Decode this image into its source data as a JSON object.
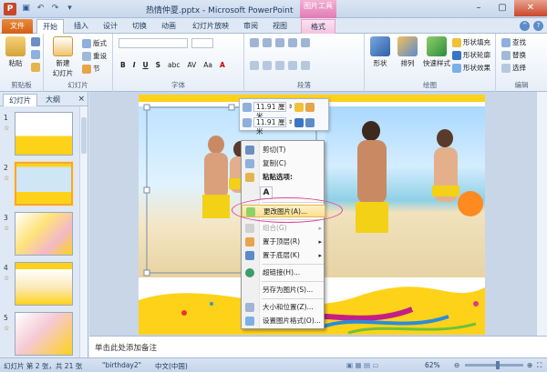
{
  "titlebar": {
    "filename": "热情仲夏.pptx",
    "app": "Microsoft PowerPoint",
    "separator": " - ",
    "context_tab_group": "图片工具"
  },
  "tabs": [
    "文件",
    "开始",
    "插入",
    "设计",
    "切换",
    "动画",
    "幻灯片放映",
    "审阅",
    "视图",
    "格式"
  ],
  "ribbon": {
    "clipboard": {
      "label": "剪贴板",
      "paste": "粘贴"
    },
    "slides": {
      "label": "幻灯片",
      "new_slide": "新建",
      "new_slide2": "幻灯片",
      "layout": "版式",
      "reset": "重设",
      "section": "节"
    },
    "font": {
      "label": "字体",
      "buttons": [
        "B",
        "I",
        "U",
        "S",
        "abc",
        "AV",
        "Aa",
        "A"
      ]
    },
    "paragraph": {
      "label": "段落"
    },
    "drawing": {
      "label": "绘图",
      "shapes": "形状",
      "arrange": "排列",
      "quick_styles": "快速样式",
      "fill": "形状填充",
      "outline": "形状轮廓",
      "effects": "形状效果"
    },
    "editing": {
      "label": "编辑",
      "find": "查找",
      "replace": "替换",
      "select": "选择"
    }
  },
  "leftpane": {
    "tab_slides": "幻灯片",
    "tab_outline": "大纲",
    "close": "×",
    "thumbnails": [
      {
        "num": "1",
        "selected": false
      },
      {
        "num": "2",
        "selected": true
      },
      {
        "num": "3",
        "selected": false
      },
      {
        "num": "4",
        "selected": false
      },
      {
        "num": "5",
        "selected": false
      }
    ]
  },
  "minibar": {
    "height_value": "11.91 厘米",
    "width_value": "11.91 厘米"
  },
  "context_menu": {
    "items": [
      {
        "label": "剪切(T)",
        "disabled": false,
        "highlight": false,
        "submenu": false
      },
      {
        "label": "复制(C)",
        "disabled": false,
        "highlight": false,
        "submenu": false
      },
      {
        "label": "粘贴选项:",
        "disabled": false,
        "highlight": false,
        "submenu": false,
        "bold": true
      },
      {
        "label": "A",
        "disabled": false,
        "highlight": false,
        "submenu": false,
        "paste_icon": true
      },
      {
        "label": "更改图片(A)...",
        "disabled": false,
        "highlight": true,
        "submenu": false
      },
      {
        "label": "组合(G)",
        "disabled": true,
        "highlight": false,
        "submenu": true
      },
      {
        "label": "置于顶层(R)",
        "disabled": false,
        "highlight": false,
        "submenu": true
      },
      {
        "label": "置于底层(K)",
        "disabled": false,
        "highlight": false,
        "submenu": true
      },
      {
        "label": "超链接(H)...",
        "disabled": false,
        "highlight": false,
        "submenu": false
      },
      {
        "label": "另存为图片(S)...",
        "disabled": false,
        "highlight": false,
        "submenu": false
      },
      {
        "label": "大小和位置(Z)...",
        "disabled": false,
        "highlight": false,
        "submenu": false
      },
      {
        "label": "设置图片格式(O)...",
        "disabled": false,
        "highlight": false,
        "submenu": false
      }
    ]
  },
  "notes": {
    "placeholder": "单击此处添加备注"
  },
  "status": {
    "slide_info": "幻灯片 第 2 张，共 21 张",
    "theme": "\"birthday2\"",
    "language": "中文(中国)",
    "zoom": "62%"
  },
  "colors": {
    "accent": "#d45f14",
    "context_pink": "#e27bb5",
    "highlight_ring": "#e0439b"
  }
}
